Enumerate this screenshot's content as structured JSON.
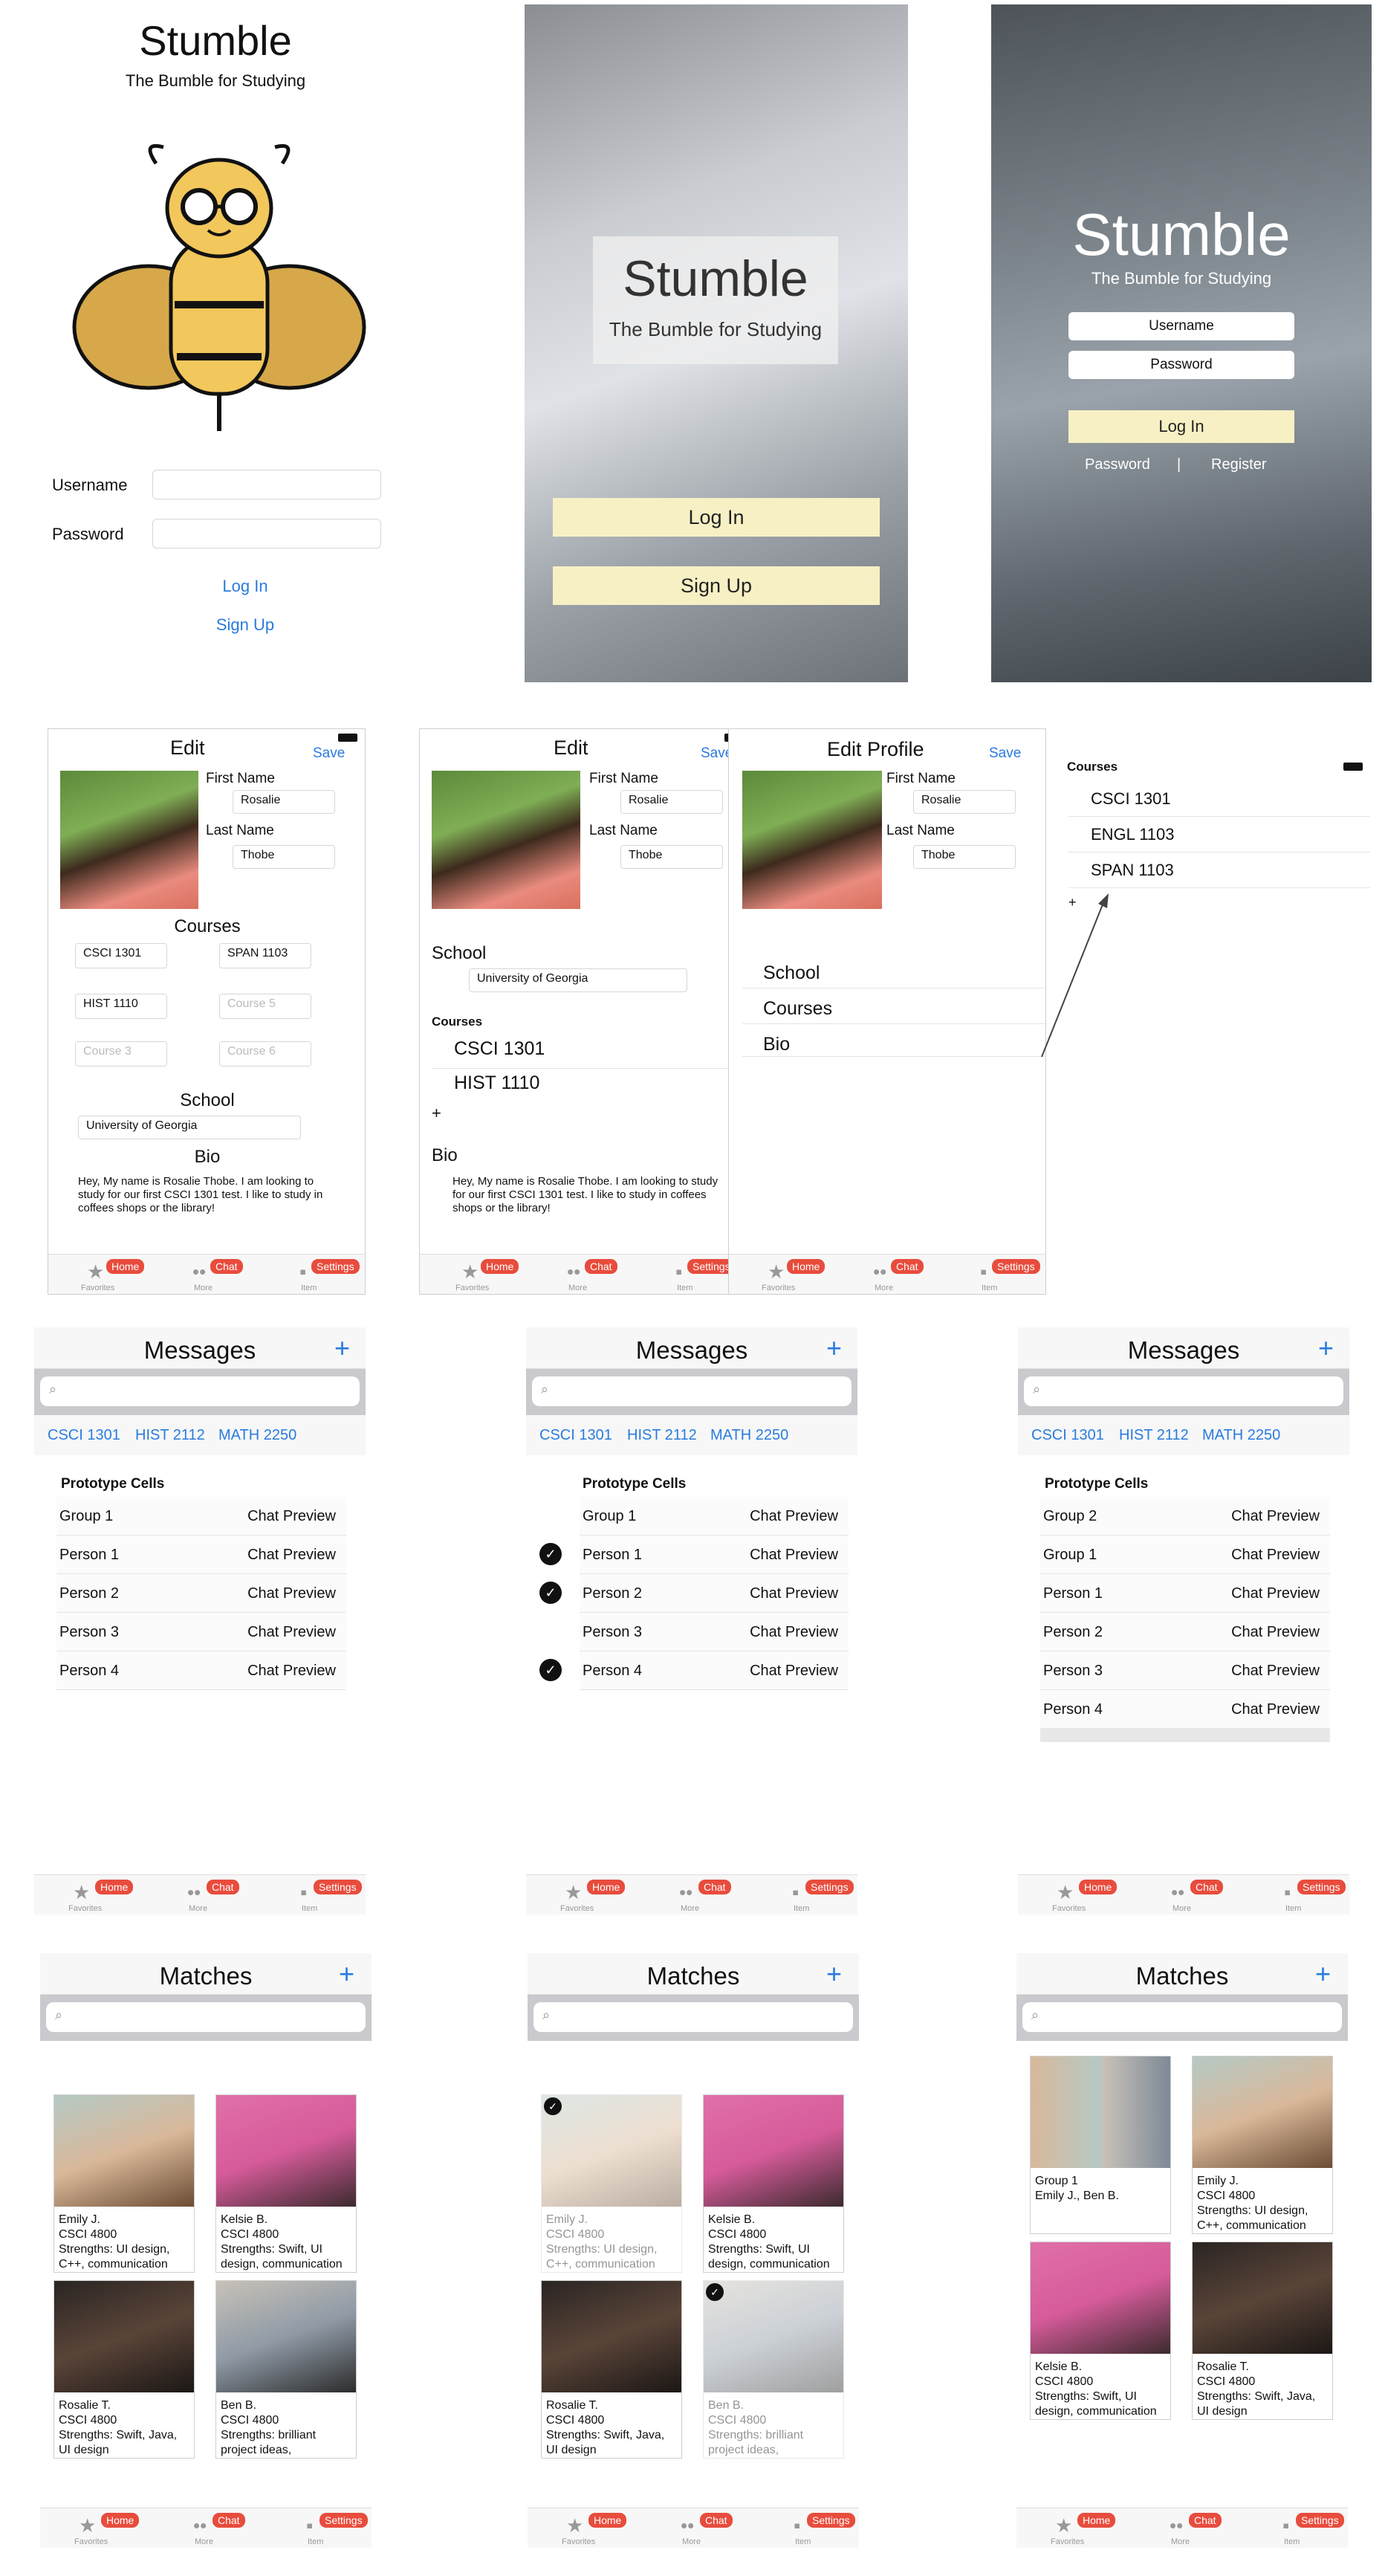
{
  "login1": {
    "title": "Stumble",
    "subtitle": "The Bumble for Studying",
    "username_label": "Username",
    "password_label": "Password",
    "login": "Log In",
    "signup": "Sign Up"
  },
  "login2": {
    "title": "Stumble",
    "subtitle": "The Bumble for Studying",
    "login": "Log In",
    "signup": "Sign Up"
  },
  "login3": {
    "title": "Stumble",
    "subtitle": "The Bumble for Studying",
    "username_ph": "Username",
    "password_ph": "Password",
    "login": "Log In",
    "forgot": "Password",
    "sep": "|",
    "register": "Register"
  },
  "edit1": {
    "title": "Edit",
    "save": "Save",
    "first_label": "First Name",
    "first": "Rosalie",
    "last_label": "Last Name",
    "last": "Thobe",
    "courses_h": "Courses",
    "c1": "CSCI 1301",
    "c2": "SPAN 1103",
    "c3": "HIST 1110",
    "c4": "Course 5",
    "c5": "Course 3",
    "c6": "Course 6",
    "school_h": "School",
    "school": "University of Georgia",
    "bio_h": "Bio",
    "bio": "Hey, My name is Rosalie Thobe.  I am looking to study for our first CSCI 1301 test.  I like to study in coffees shops or the library!"
  },
  "edit2": {
    "title": "Edit",
    "save": "Save",
    "first_label": "First Name",
    "first": "Rosalie",
    "last_label": "Last Name",
    "last": "Thobe",
    "school_h": "School",
    "school": "University of Georgia",
    "courses_h": "Courses",
    "c1": "CSCI 1301",
    "c2": "HIST 1110",
    "plus": "+",
    "bio_h": "Bio",
    "bio": "Hey, My name is Rosalie Thobe.  I am looking to study for our first CSCI 1301 test.  I like to study in coffees shops or the library!"
  },
  "edit3": {
    "title": "Edit Profile",
    "save": "Save",
    "first_label": "First Name",
    "first": "Rosalie",
    "last_label": "Last Name",
    "last": "Thobe",
    "rows": [
      "School",
      "Courses",
      "Bio"
    ]
  },
  "courses_panel": {
    "header": "Courses",
    "items": [
      "CSCI 1301",
      "ENGL 1103",
      "SPAN 1103"
    ],
    "plus": "+"
  },
  "tabbar": {
    "home": "Home",
    "chat": "Chat",
    "settings": "Settings",
    "fav": "Favorites",
    "more": "More",
    "item": "Item"
  },
  "messages": {
    "title": "Messages",
    "plus": "+",
    "chips": [
      "CSCI 1301",
      "HIST 2112",
      "MATH 2250"
    ],
    "section": "Prototype Cells",
    "preview": "Chat Preview",
    "list_a": [
      "Group 1",
      "Person 1",
      "Person 2",
      "Person 3",
      "Person 4"
    ],
    "list_b": [
      "Group 1",
      "Person 1",
      "Person 2",
      "Person 3",
      "Person 4"
    ],
    "list_c": [
      "Group 2",
      "Group 1",
      "Person 1",
      "Person 2",
      "Person 3",
      "Person 4"
    ]
  },
  "matches": {
    "title": "Matches",
    "plus": "+",
    "emily": "Emily J.\nCSCI 4800\nStrengths: UI design,\nC++, communication",
    "kelsie": "Kelsie B.\nCSCI 4800\nStrengths: Swift, UI\ndesign, communication",
    "rosalie": "Rosalie T.\nCSCI 4800\nStrengths: Swift, Java,\nUI design",
    "ben": "Ben B.\nCSCI 4800\nStrengths: brilliant\nproject ideas,",
    "group": "Group 1\nEmily J., Ben B."
  },
  "colors": {
    "accent": "#2a7bde",
    "badge": "#e84c3d",
    "cream": "#f7f0c4",
    "bee": "#f2c75c"
  }
}
